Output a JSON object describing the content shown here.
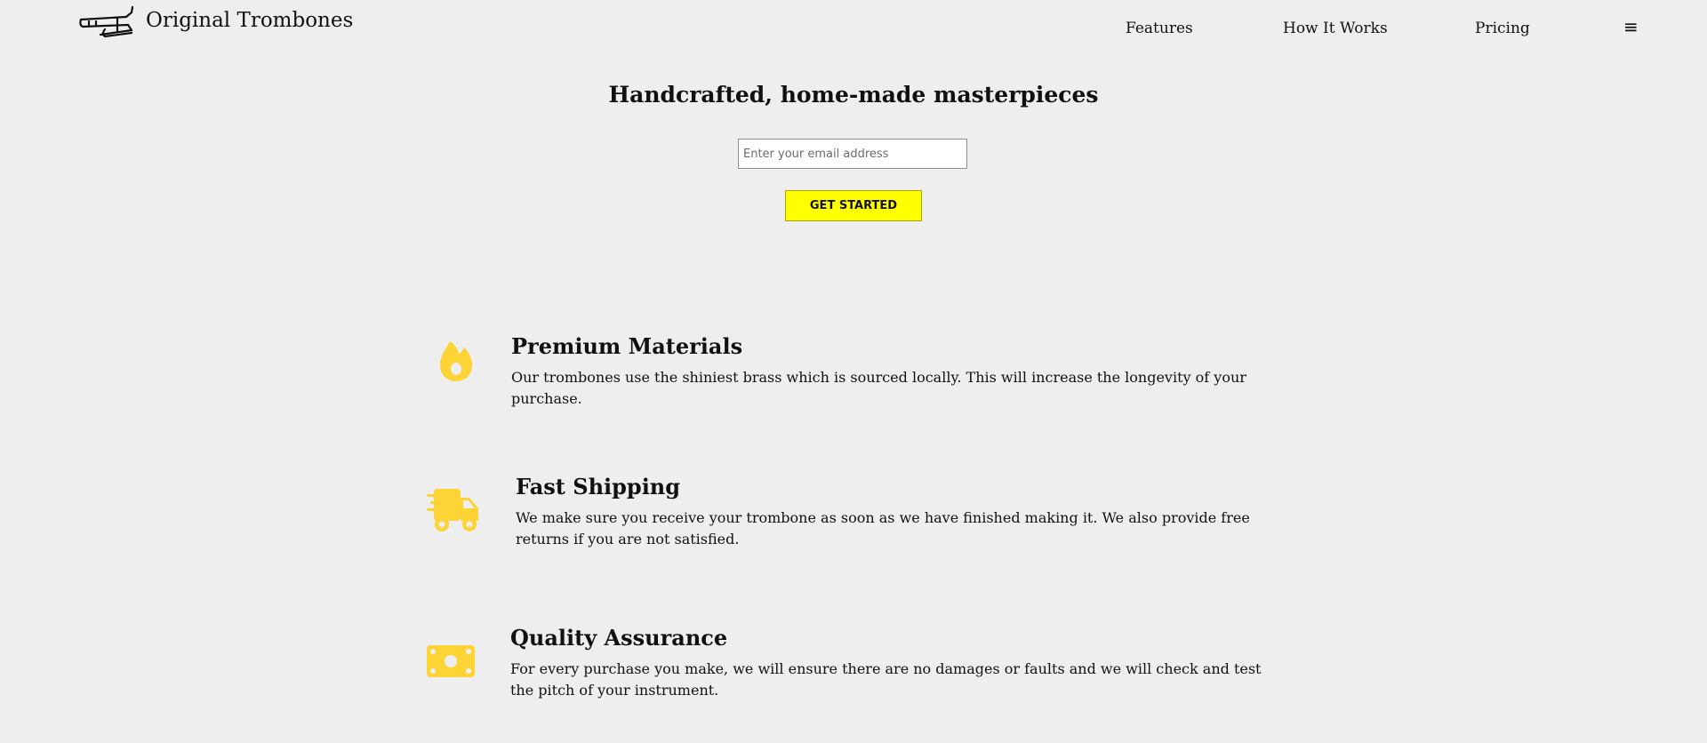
{
  "brand": {
    "name": "Original Trombones",
    "logo_icon": "trombone-icon"
  },
  "nav": {
    "items": [
      {
        "label": "Features"
      },
      {
        "label": "How It Works"
      },
      {
        "label": "Pricing"
      }
    ],
    "menu_icon": "≡"
  },
  "hero": {
    "title": "Handcrafted, home-made masterpieces",
    "email_placeholder": "Enter your email address",
    "email_value": "",
    "cta_label": "GET STARTED"
  },
  "features": [
    {
      "icon": "fire-icon",
      "title": "Premium Materials",
      "description": "Our trombones use the shiniest brass which is sourced locally. This will increase the longevity of your purchase."
    },
    {
      "icon": "truck-icon",
      "title": "Fast Shipping",
      "description": "We make sure you receive your trombone as soon as we have finished making it. We also provide free returns if you are not satisfied."
    },
    {
      "icon": "money-bill-icon",
      "title": "Quality Assurance",
      "description": "For every purchase you make, we will ensure there are no damages or faults and we will check and test the pitch of your instrument."
    }
  ],
  "colors": {
    "accent": "#ffff00",
    "icon": "#fdd335",
    "background": "#eeeeee"
  }
}
